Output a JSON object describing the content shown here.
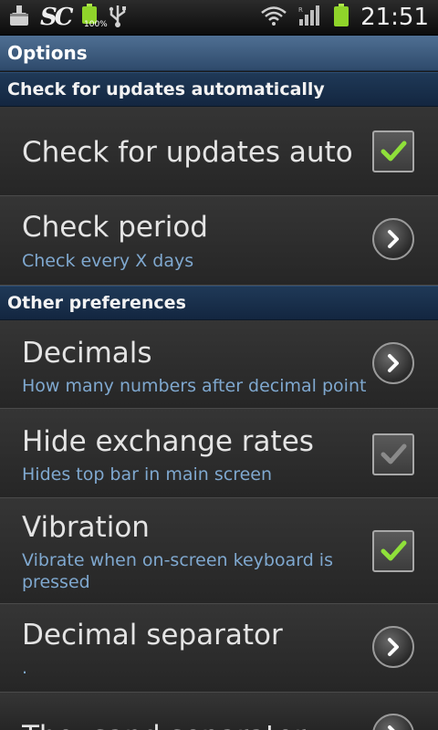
{
  "status_bar": {
    "time": "21:51",
    "battery_percent": "100%",
    "icons": [
      "download-icon",
      "sc-app-icon",
      "battery-charging-icon",
      "usb-icon",
      "wifi-icon",
      "signal-icon",
      "battery-icon"
    ],
    "sc_logo": "SC"
  },
  "title": "Options",
  "categories": [
    {
      "label": "Check for updates automatically"
    },
    {
      "label": "Other preferences"
    }
  ],
  "prefs": [
    {
      "title": "Check for updates automatically",
      "summary": "",
      "widget": "checkbox",
      "checked": true
    },
    {
      "title": "Check period",
      "summary": "Check every X days",
      "widget": "chevron"
    },
    {
      "title": "Decimals",
      "summary": "How many numbers after decimal point",
      "widget": "chevron"
    },
    {
      "title": "Hide exchange rates",
      "summary": "Hides top bar in main screen",
      "widget": "checkbox",
      "checked": true,
      "check_style": "dim"
    },
    {
      "title": "Vibration",
      "summary_line1": "Vibrate when on-screen keyboard is",
      "summary_line2": "pressed",
      "widget": "checkbox",
      "checked": true
    },
    {
      "title": "Decimal separator",
      "summary": ".",
      "widget": "chevron"
    },
    {
      "title": "Thousand separator",
      "summary": "",
      "widget": "chevron"
    }
  ],
  "colors": {
    "check_green": "#8fe03a",
    "summary_blue": "#7fa8cf",
    "title_bar": "#3d5c80"
  }
}
